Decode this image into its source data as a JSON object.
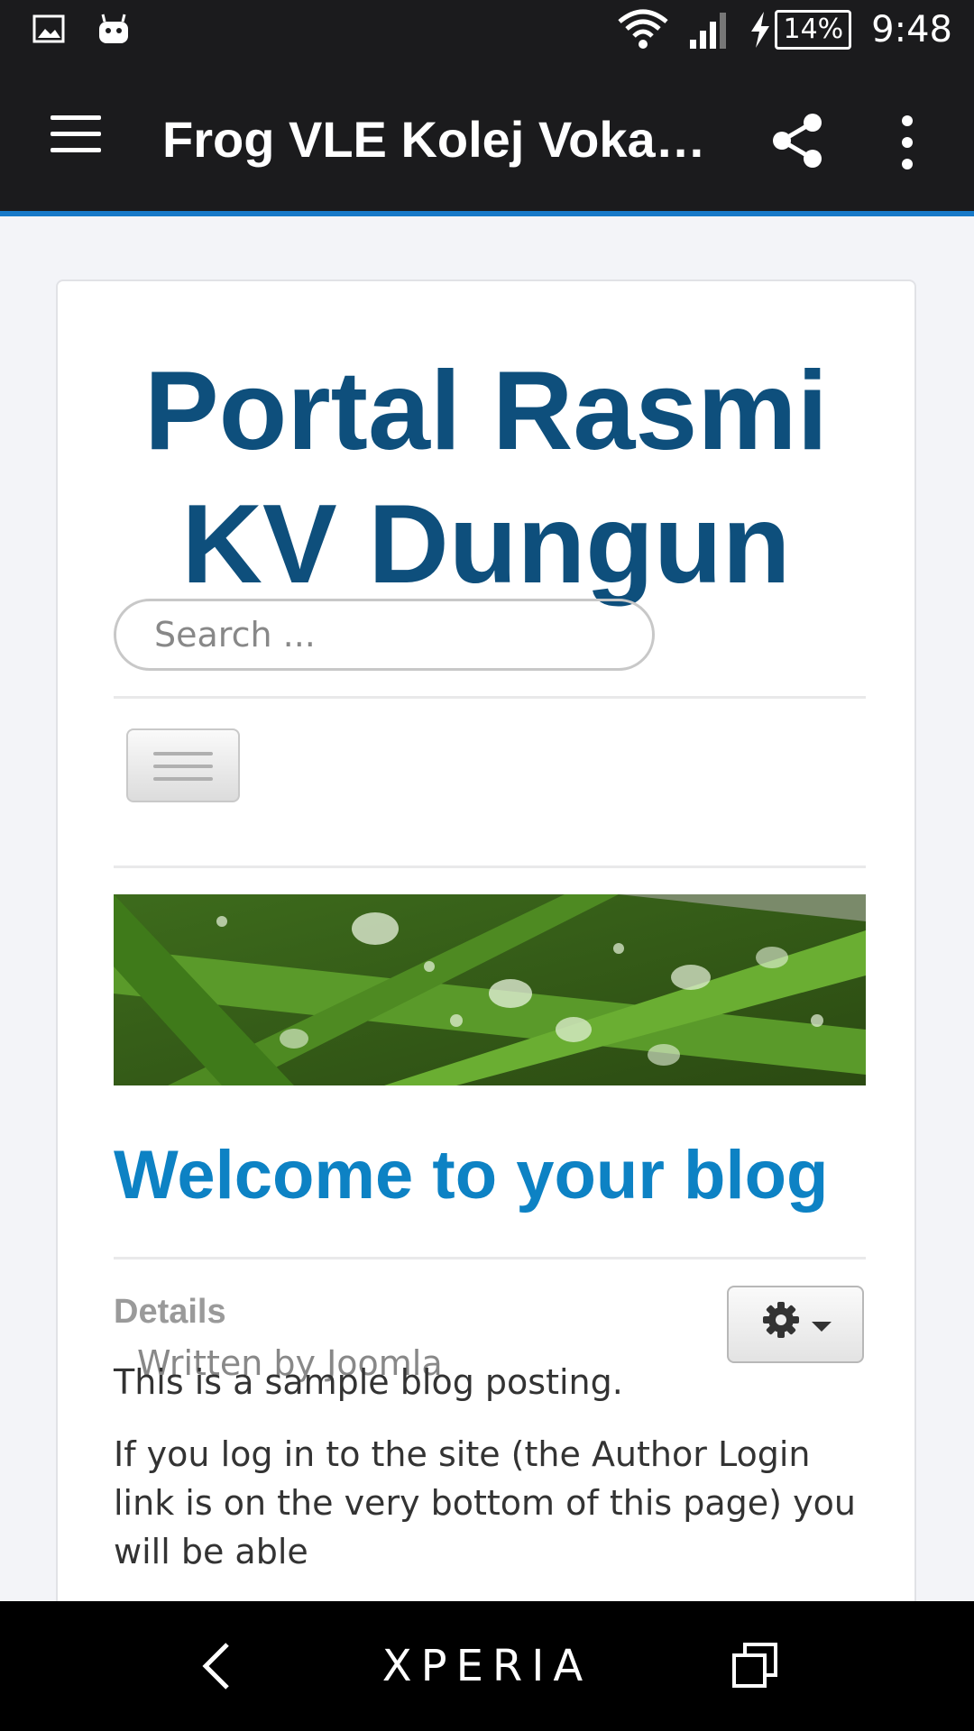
{
  "status_bar": {
    "battery": "14%",
    "time": "9:48"
  },
  "app_bar": {
    "title": "Frog VLE Kolej Vokas..."
  },
  "site": {
    "title_line1": "Portal Rasmi",
    "title_line2": "KV Dungun",
    "search_placeholder": "Search ..."
  },
  "article": {
    "title": "Welcome to your blog",
    "details_label": "Details",
    "author": "Written by Joomla",
    "paragraphs": [
      "This is a sample blog posting.",
      "If you log in to the site (the Author Login link is on the very bottom of this page) you will be able"
    ]
  },
  "nav_bar": {
    "brand": "XPERIA"
  },
  "colors": {
    "site_title": "#0e4f7c",
    "blog_title": "#0d82c4",
    "app_bar_accent": "#1779c8"
  }
}
